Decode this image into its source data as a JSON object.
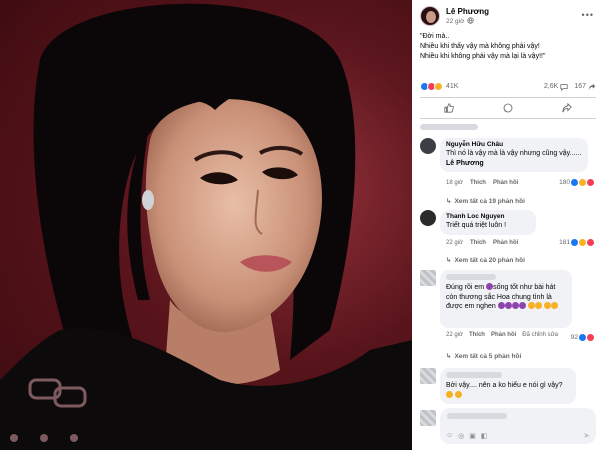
{
  "post": {
    "author": "Lê Phương",
    "time": "22 giờ",
    "privacy_icon": "globe-icon",
    "text_lines": [
      "\"Đời mà..",
      "Nhiều khi thấy vậy mà không phải vậy!",
      "Nhiều khi không phải vậy mà lại là vậy!!\""
    ],
    "reaction_count": "41K",
    "reaction_icons": [
      "like-reaction-icon",
      "love-reaction-icon",
      "haha-reaction-icon"
    ],
    "comments_count": "2,6K",
    "shares_count": "167",
    "actions": [
      {
        "icon": "like-icon"
      },
      {
        "icon": "comment-icon"
      },
      {
        "icon": "share-icon"
      }
    ]
  },
  "comments": [
    {
      "name": "Nguyễn Hữu Châu",
      "text": "Thì nó là vậy mà là vậy nhưng cũng vậy...... ",
      "mention": "Lê Phương",
      "time": "18 giờ",
      "like": "Thích",
      "reply": "Phản hồi",
      "reacts": "180",
      "view_replies": "Xem tất cả 19 phản hồi"
    },
    {
      "name": "Thanh Loc Nguyen",
      "text": "Triết quá triệt luôn !",
      "time": "22 giờ",
      "like": "Thích",
      "reply": "Phản hồi",
      "reacts": "181",
      "view_replies": "Xem tất cả 20 phản hồi"
    },
    {
      "text_a": "Đúng rồi em ",
      "text_b": "sống tốt như bài hát còn thương sắc Hoa chung tình là được em nghen",
      "time": "22 giờ",
      "like": "Thích",
      "reply": "Phản hồi",
      "edited": "Đã chỉnh sửa",
      "reacts": "92",
      "view_replies": "Xem tất cả 5 phản hồi"
    },
    {
      "text": "Bởi vậy.... nên a ko hiểu e nói gì vậy?"
    }
  ],
  "composer": {
    "icons": [
      "emoji-icon",
      "camera-icon",
      "gif-icon",
      "sticker-icon",
      "send-icon"
    ]
  },
  "colors": {
    "background_photo": "#5a141b",
    "panel_bg": "#ffffff",
    "bubble_bg": "#f0f2f5",
    "text_primary": "#050505",
    "text_secondary": "#65676b",
    "like_blue": "#1877f2",
    "love_red": "#f33e58",
    "haha_yellow": "#f7b125"
  }
}
